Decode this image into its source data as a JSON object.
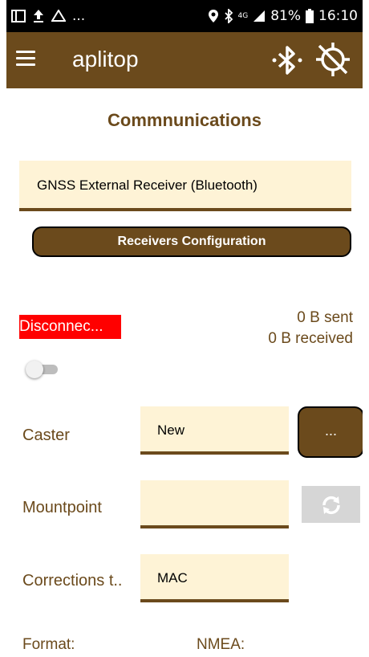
{
  "status_bar": {
    "left_more": "...",
    "battery": "81%",
    "time": "16:10",
    "signal_label": "4G"
  },
  "app_bar": {
    "title": "aplitop"
  },
  "page": {
    "title": "Commnunications"
  },
  "receiver": {
    "value": "GNSS External Receiver (Bluetooth)"
  },
  "config_button": {
    "label": "Receivers Configuration"
  },
  "connection": {
    "status": "Disconnec...",
    "sent": "0 B sent",
    "received": "0 B received",
    "toggle_on": false
  },
  "form": {
    "caster_label": "Caster",
    "caster_value": "New",
    "caster_more_label": "...",
    "mountpoint_label": "Mountpoint",
    "mountpoint_value": "",
    "corrections_label": "Corrections t..",
    "corrections_value": "MAC",
    "format_label": "Format:",
    "nmea_label": "NMEA:"
  },
  "colors": {
    "brand": "#6b4a1c",
    "field_bg": "#fef3d6",
    "status_error": "#ff0000",
    "disabled_button": "#d6d6d6"
  },
  "icons": [
    "media-icon",
    "upload-icon",
    "drive-icon",
    "location-pin-icon",
    "bluetooth-icon",
    "signal-icon",
    "battery-icon",
    "menu-icon",
    "bluetooth-off-icon",
    "gps-off-icon",
    "refresh-icon"
  ]
}
